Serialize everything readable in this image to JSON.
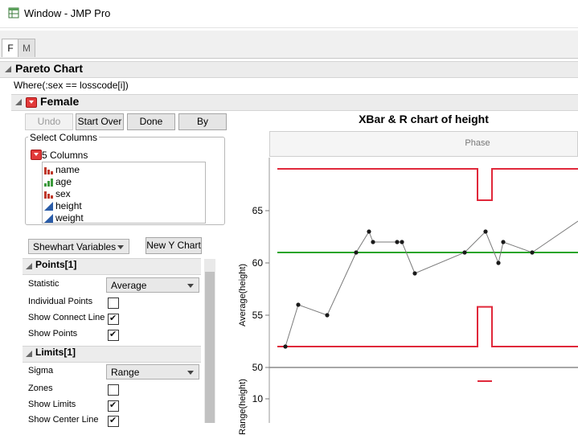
{
  "window": {
    "title": "Window - JMP Pro",
    "icon": "jmp-table-icon"
  },
  "tabs": [
    {
      "label": "F"
    },
    {
      "label": "M"
    }
  ],
  "report": {
    "title": "Pareto Chart",
    "where": "Where(:sex == losscode[i])",
    "group_title": "Female"
  },
  "toolbar": {
    "undo": "Undo",
    "start_over": "Start Over",
    "done": "Done",
    "by": "By"
  },
  "select_columns": {
    "title": "Select Columns",
    "count_label": "5 Columns",
    "columns": [
      {
        "name": "name",
        "type": "nominal",
        "color": "#c0392b"
      },
      {
        "name": "age",
        "type": "ordinal",
        "color": "#3c9a3c"
      },
      {
        "name": "sex",
        "type": "nominal",
        "color": "#c0392b"
      },
      {
        "name": "height",
        "type": "continuous",
        "color": "#2a5ca8"
      },
      {
        "name": "weight",
        "type": "continuous",
        "color": "#2a5ca8"
      }
    ]
  },
  "chart_type": {
    "selected": "Shewhart Variables"
  },
  "new_y_chart": "New Y Chart",
  "points_panel": {
    "title": "Points[1]",
    "statistic_label": "Statistic",
    "statistic_value": "Average",
    "individual_points": "Individual Points",
    "individual_points_checked": false,
    "show_connect_line": "Show Connect Line",
    "show_connect_line_checked": true,
    "show_points": "Show Points",
    "show_points_checked": true
  },
  "limits_panel": {
    "title": "Limits[1]",
    "sigma_label": "Sigma",
    "sigma_value": "Range",
    "zones": "Zones",
    "zones_checked": false,
    "show_limits": "Show Limits",
    "show_limits_checked": true,
    "show_center_line": "Show Center Line",
    "show_center_line_checked": true
  },
  "chart_data": {
    "type": "line",
    "title": "XBar & R chart of height",
    "phase_label": "Phase",
    "ylabel": "Average(height)",
    "ylabel2": "Range(height)",
    "yticks": [
      50,
      55,
      60,
      65
    ],
    "yticks2": [
      10
    ],
    "center_line": 61,
    "ucl_phase1": 69,
    "lcl_phase1": 52,
    "ucl_phase2": 66,
    "lcl_phase2": 55.8,
    "values": [
      52,
      56,
      55,
      61,
      63,
      62,
      62,
      62,
      59,
      61,
      63,
      60,
      62,
      61,
      64
    ],
    "colors": {
      "limits": "#e0283a",
      "center": "#2aa52a",
      "line": "#7a7a7a",
      "point": "#1a1a1a"
    }
  }
}
